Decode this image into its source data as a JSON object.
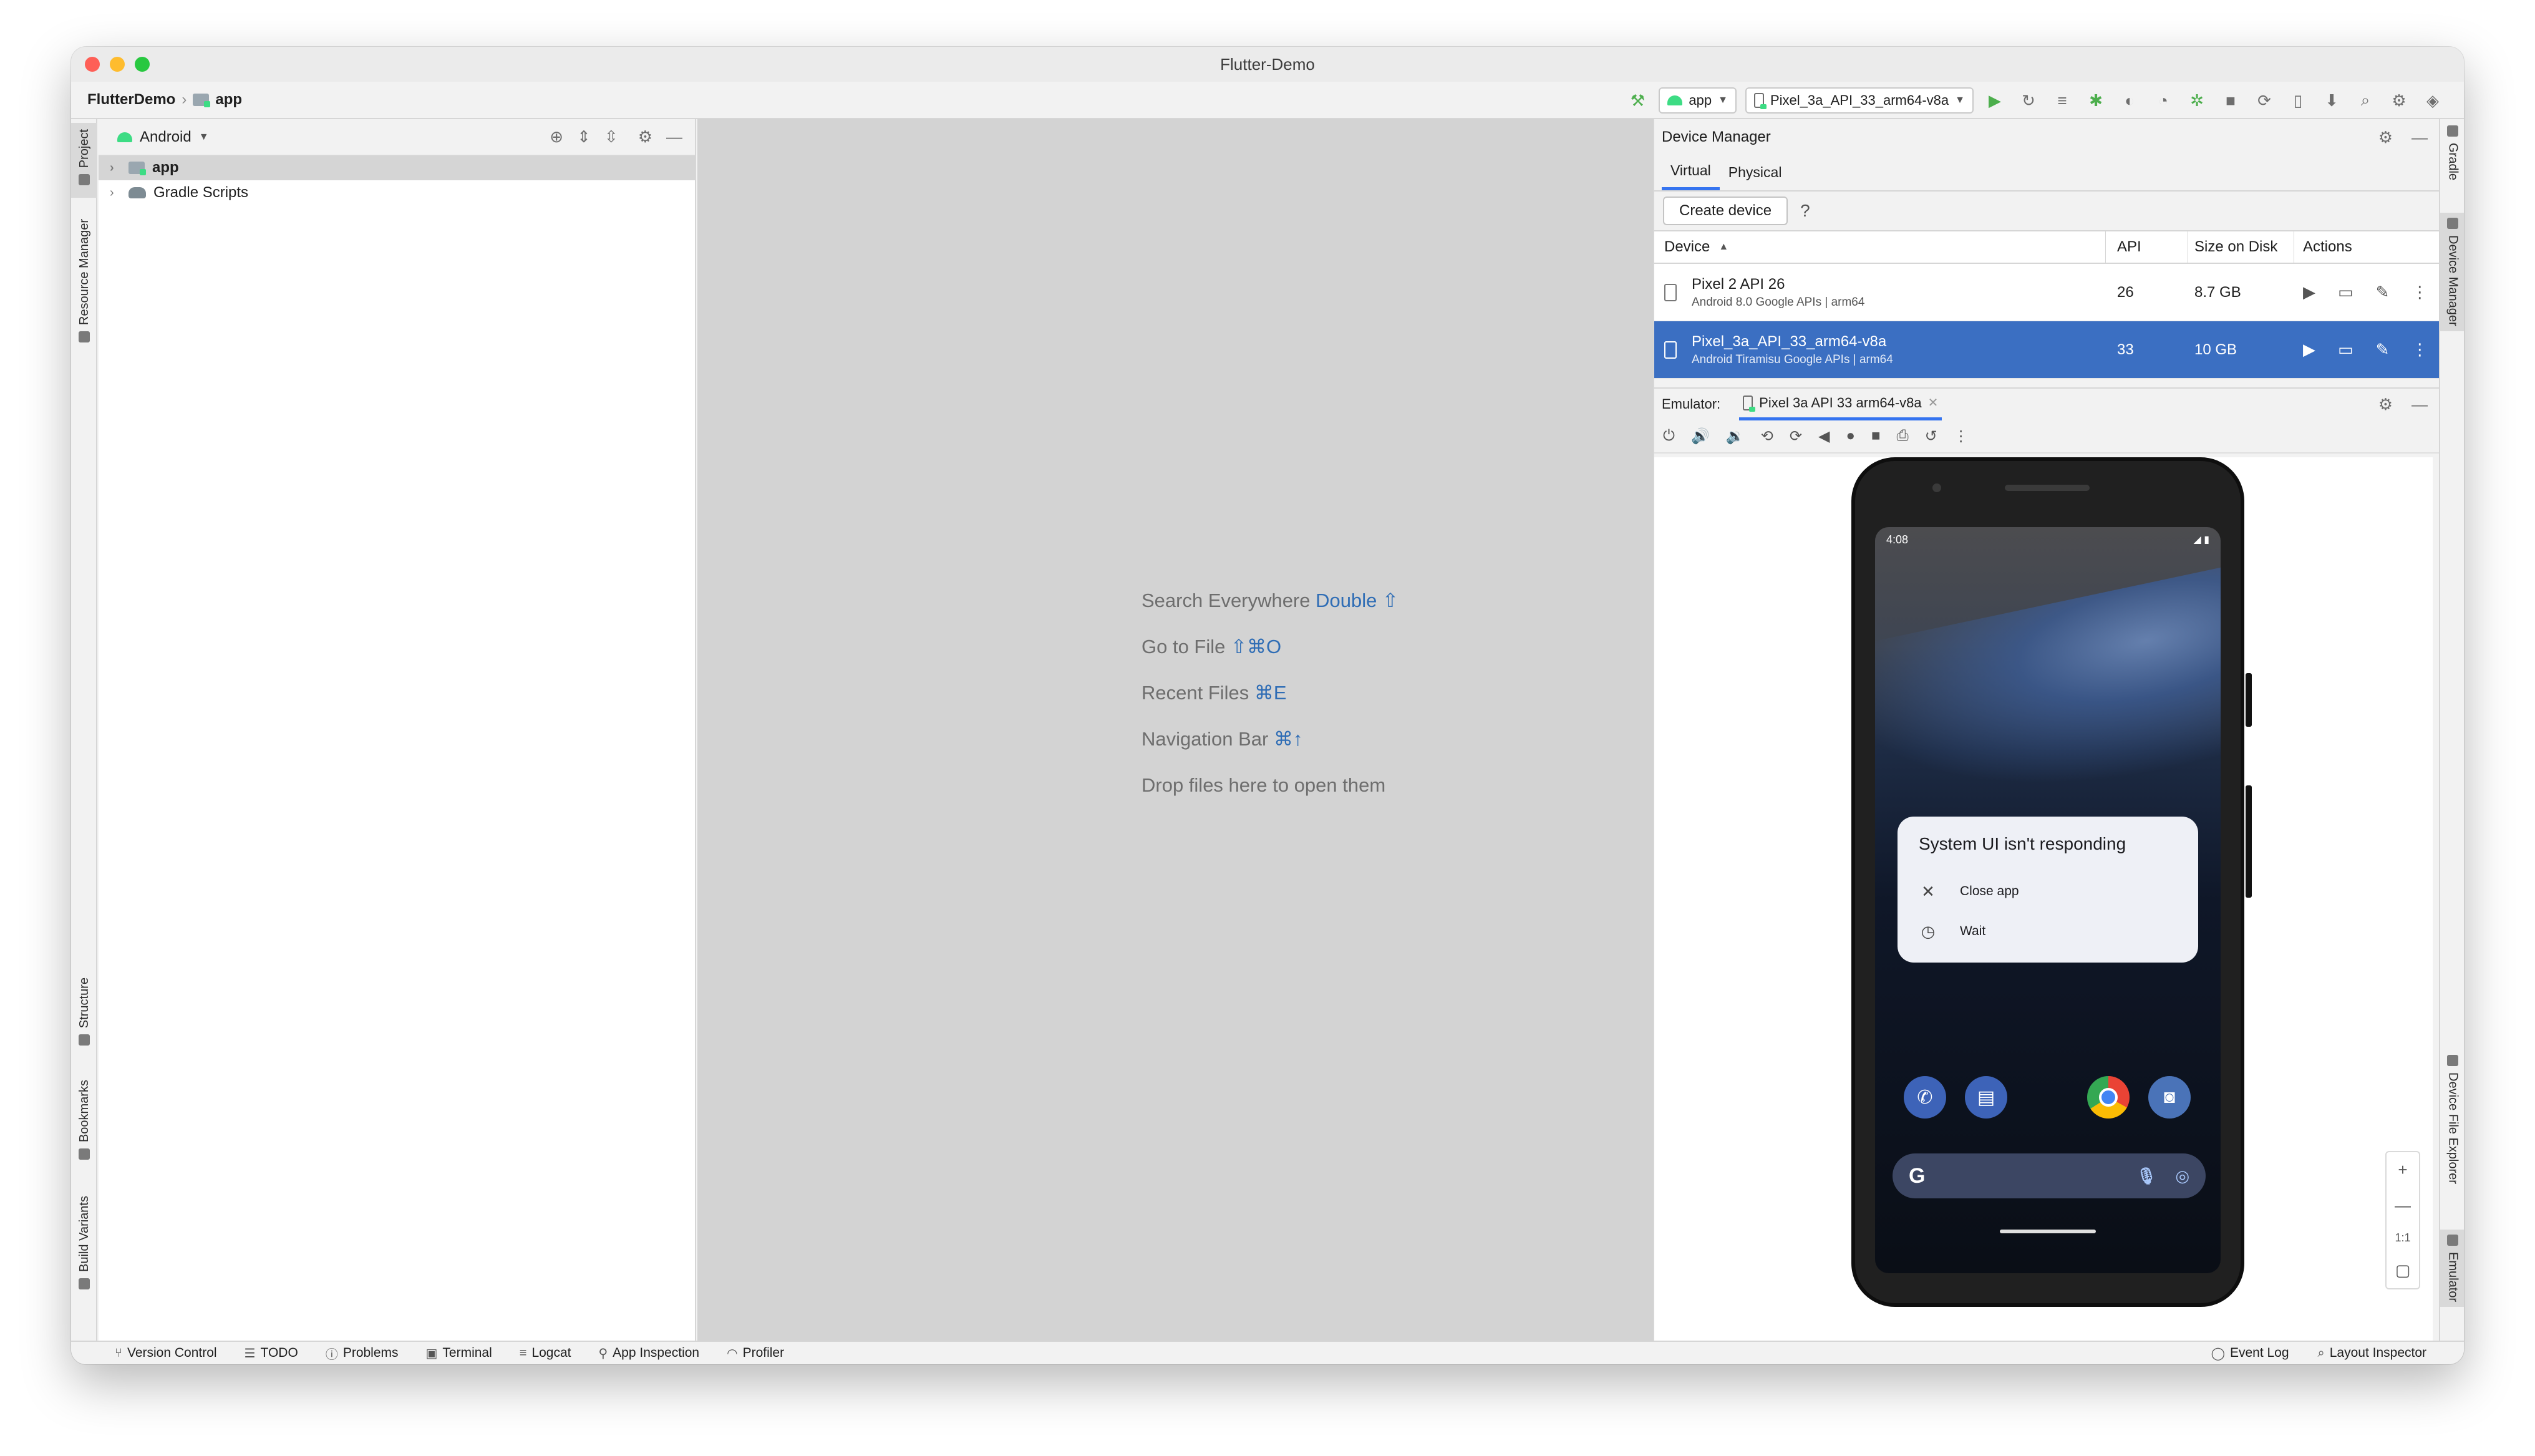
{
  "window": {
    "title": "Flutter-Demo"
  },
  "breadcrumb": {
    "project": "FlutterDemo",
    "module": "app"
  },
  "toolbar": {
    "config": "app",
    "device": "Pixel_3a_API_33_arm64-v8a"
  },
  "left_tabs": {
    "project": "Project",
    "resource_manager": "Resource Manager",
    "structure": "Structure",
    "bookmarks": "Bookmarks",
    "build_variants": "Build Variants"
  },
  "project_panel": {
    "view": "Android",
    "items": [
      {
        "label": "app"
      },
      {
        "label": "Gradle Scripts"
      }
    ]
  },
  "editor_hints": {
    "search": {
      "text": "Search Everywhere",
      "key": "Double ⇧"
    },
    "goto": {
      "text": "Go to File",
      "key": "⇧⌘O"
    },
    "recent": {
      "text": "Recent Files",
      "key": "⌘E"
    },
    "navbar": {
      "text": "Navigation Bar",
      "key": "⌘↑"
    },
    "drop": {
      "text": "Drop files here to open them"
    }
  },
  "device_manager": {
    "title": "Device Manager",
    "tabs": [
      "Virtual",
      "Physical"
    ],
    "create_button": "Create device",
    "help": "?",
    "columns": {
      "device": "Device",
      "api": "API",
      "size": "Size on Disk",
      "actions": "Actions"
    },
    "rows": [
      {
        "name": "Pixel 2 API 26",
        "sub": "Android 8.0 Google APIs | arm64",
        "api": "26",
        "size": "8.7 GB"
      },
      {
        "name": "Pixel_3a_API_33_arm64-v8a",
        "sub": "Android Tiramisu Google APIs | arm64",
        "api": "33",
        "size": "10 GB"
      }
    ]
  },
  "emulator": {
    "label": "Emulator:",
    "tab": "Pixel 3a API 33 arm64-v8a",
    "time": "4:08",
    "dialog": {
      "title": "System UI isn't responding",
      "close": "Close app",
      "wait": "Wait"
    },
    "search_logo": "G",
    "zoom_fit": "1:1"
  },
  "right_tabs": {
    "gradle": "Gradle",
    "device_manager": "Device Manager",
    "device_file_explorer": "Device File Explorer",
    "emulator": "Emulator"
  },
  "bottom_tabs": {
    "version_control": "Version Control",
    "todo": "TODO",
    "problems": "Problems",
    "terminal": "Terminal",
    "logcat": "Logcat",
    "app_inspection": "App Inspection",
    "profiler": "Profiler",
    "event_log": "Event Log",
    "layout_inspector": "Layout Inspector"
  }
}
